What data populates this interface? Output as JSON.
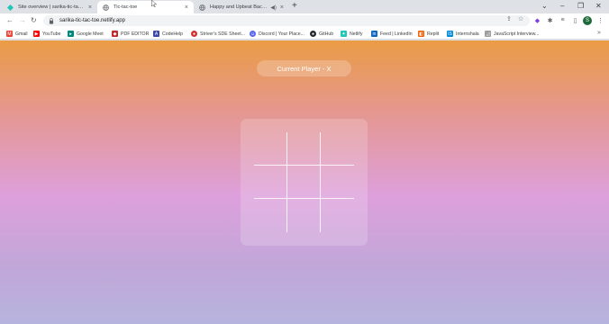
{
  "tabs": [
    {
      "title": "Site overview | sarika-tic-tac-toe",
      "icon": "netlify-icon",
      "active": false
    },
    {
      "title": "Tic-tac-toe",
      "icon": "globe-icon",
      "active": true
    },
    {
      "title": "Happy and Upbeat Backgro",
      "icon": "globe-icon",
      "active": false
    }
  ],
  "toolbar": {
    "url": "sarika-tic-tac-toe.netlify.app",
    "profile_initial": "S"
  },
  "bookmarks": [
    {
      "label": "Gmail",
      "icon": "gmail-icon",
      "color": "#ea4335"
    },
    {
      "label": "YouTube",
      "icon": "youtube-icon",
      "color": "#ff0000"
    },
    {
      "label": "Google Meet",
      "icon": "meet-icon",
      "color": "#00897b"
    },
    {
      "label": "PDF EDITOR",
      "icon": "pdf-icon",
      "color": "#c62828"
    },
    {
      "label": "CodeHelp",
      "icon": "codehelp-icon",
      "color": "#3949ab"
    },
    {
      "label": "Striver's SDE Sheet...",
      "icon": "striver-icon",
      "color": "#d32f2f"
    },
    {
      "label": "Discord | Your Place...",
      "icon": "discord-icon",
      "color": "#5865f2"
    },
    {
      "label": "GitHub",
      "icon": "github-icon",
      "color": "#24292e"
    },
    {
      "label": "Netlify",
      "icon": "netlify-icon",
      "color": "#20c6b7"
    },
    {
      "label": "Feed | LinkedIn",
      "icon": "linkedin-icon",
      "color": "#0a66c2"
    },
    {
      "label": "Replit",
      "icon": "replit-icon",
      "color": "#f26207"
    },
    {
      "label": "Internshala",
      "icon": "internshala-icon",
      "color": "#008bdc"
    },
    {
      "label": "JavaScript Interview...",
      "icon": "js-icon",
      "color": "#9e9e9e"
    }
  ],
  "game": {
    "status": "Current Player - X",
    "cells": [
      "",
      "",
      "",
      "",
      "",
      "",
      "",
      "",
      ""
    ]
  }
}
